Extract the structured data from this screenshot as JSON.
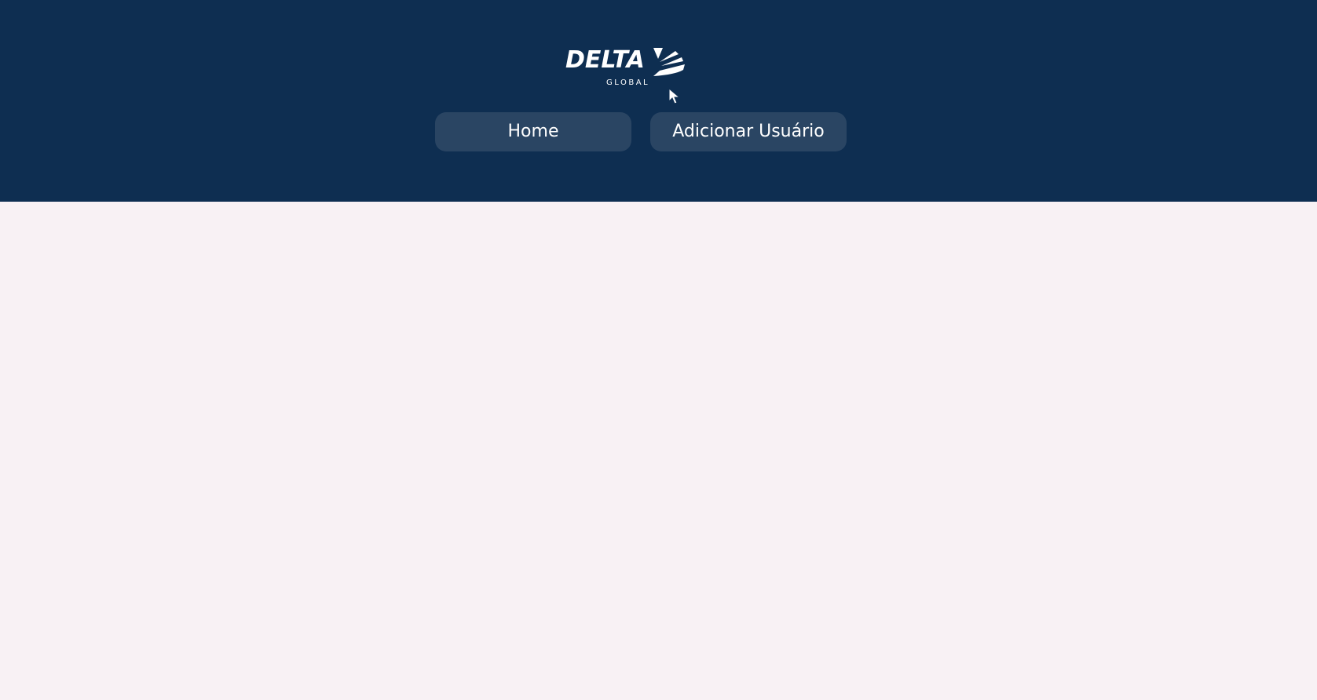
{
  "brand": {
    "name": "DELTA",
    "subtitle": "GLOBAL"
  },
  "nav": {
    "home_label": "Home",
    "add_user_label": "Adicionar Usuário"
  },
  "colors": {
    "header_bg": "#0e2e51",
    "button_bg": "#2a4563",
    "page_bg": "#f8f1f4",
    "text": "#ffffff"
  },
  "icons": {
    "logo_mark": "delta-wing-icon",
    "cursor": "mouse-pointer-icon"
  }
}
